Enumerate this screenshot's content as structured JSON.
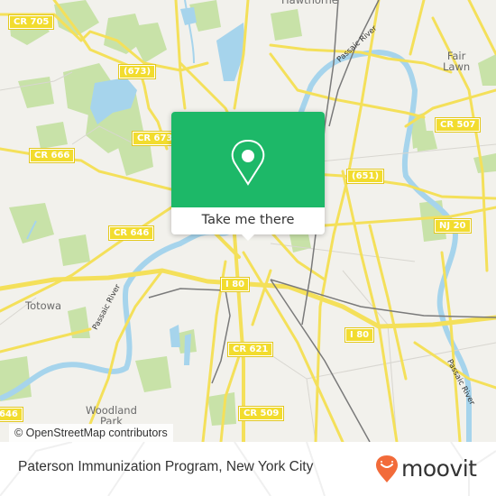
{
  "map": {
    "colors": {
      "land": "#f2f1ec",
      "park": "#c8e2a8",
      "water": "#a6d4ec",
      "road_major": "#f4e05a",
      "road_minor": "#d8d6d0",
      "rail": "#7a7a7a"
    },
    "route_shields": [
      {
        "label": "CR 705"
      },
      {
        "label": "(673)"
      },
      {
        "label": "CR 673"
      },
      {
        "label": "CR 666"
      },
      {
        "label": "CR 507"
      },
      {
        "label": "(651)"
      },
      {
        "label": "NJ 20"
      },
      {
        "label": "CR 646"
      },
      {
        "label": "I 80"
      },
      {
        "label": "I 80"
      },
      {
        "label": "CR 621"
      },
      {
        "label": "CR 509"
      },
      {
        "label": "646"
      }
    ],
    "places": [
      {
        "label": "Hawthorne"
      },
      {
        "label": "Fair\nLawn"
      },
      {
        "label": "Totowa"
      },
      {
        "label": "Woodland\nPark"
      }
    ],
    "rivers": [
      {
        "label": "Passaic River"
      },
      {
        "label": "Passaic River"
      },
      {
        "label": "Passaic River"
      }
    ],
    "attribution": "© OpenStreetMap contributors"
  },
  "popup": {
    "icon": "map-pin-icon",
    "button_label": "Take me there",
    "accent_color": "#1db868"
  },
  "footer": {
    "title": "Paterson Immunization Program, New York City",
    "brand": {
      "name": "moovit",
      "icon": "moovit-smiley-pin-icon",
      "color": "#f26b3a"
    }
  }
}
